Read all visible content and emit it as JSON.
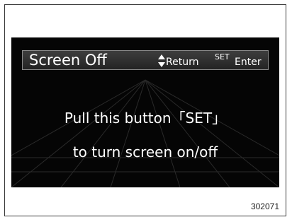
{
  "screen": {
    "header": {
      "title": "Screen Off",
      "return_label": "Return",
      "set_label": "SET",
      "enter_label": "Enter"
    },
    "message": {
      "line1": "Pull this button「SET」",
      "line2": "to turn screen on/off"
    }
  },
  "figure_number": "302071",
  "icons": {
    "navigation": "up-down-arrow-icon"
  },
  "colors": {
    "screen_background": "#050505",
    "text": "#ffffff",
    "header_background": "#2e2e2e"
  }
}
